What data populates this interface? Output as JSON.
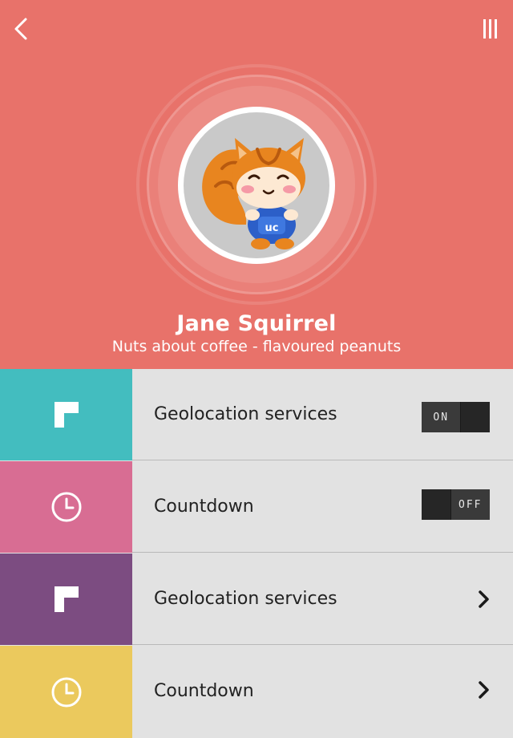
{
  "header": {
    "back_icon": "chevron-left-icon",
    "menu_icon": "vertical-bars-icon",
    "background_color": "#e8726a"
  },
  "profile": {
    "name": "Jane Squirrel",
    "status": "Nuts about coffee - flavoured peanuts",
    "avatar": "squirrel-mascot"
  },
  "settings": [
    {
      "label": "Geolocation services",
      "icon": "flag-corner-icon",
      "color": "#43bdbf",
      "control": "toggle",
      "state_label": "ON"
    },
    {
      "label": "Countdown",
      "icon": "clock-icon",
      "color": "#d86d93",
      "control": "toggle",
      "state_label": "OFF"
    },
    {
      "label": "Geolocation services",
      "icon": "flag-corner-icon",
      "color": "#7c4c81",
      "control": "chevron"
    },
    {
      "label": "Countdown",
      "icon": "clock-icon",
      "color": "#ebc95d",
      "control": "chevron"
    }
  ]
}
